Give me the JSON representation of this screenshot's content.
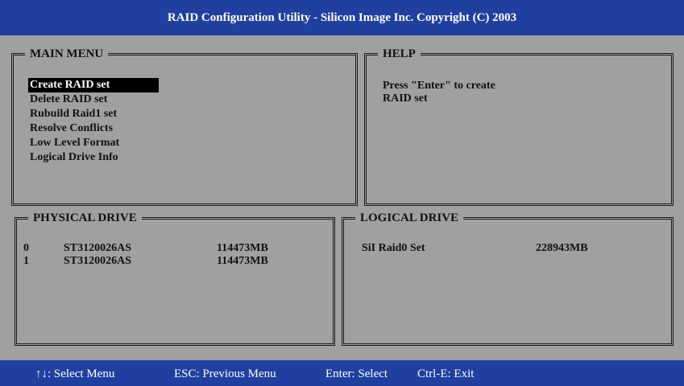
{
  "title": "RAID Configuration Utility - Silicon Image Inc. Copyright (C) 2003",
  "main_menu": {
    "title": "MAIN MENU",
    "items": [
      {
        "label": "Create RAID set",
        "selected": true
      },
      {
        "label": "Delete RAID set",
        "selected": false
      },
      {
        "label": "Rubuild Raid1 set",
        "selected": false
      },
      {
        "label": "Resolve Conflicts",
        "selected": false
      },
      {
        "label": "Low Level Format",
        "selected": false
      },
      {
        "label": "Logical Drive Info",
        "selected": false
      }
    ]
  },
  "help": {
    "title": "HELP",
    "lines": [
      "Press \"Enter\" to create",
      "RAID set"
    ]
  },
  "physical_drive": {
    "title": "PHYSICAL DRIVE",
    "rows": [
      {
        "index": "0",
        "model": "ST3120026AS",
        "size": "114473MB"
      },
      {
        "index": "1",
        "model": "ST3120026AS",
        "size": "114473MB"
      }
    ]
  },
  "logical_drive": {
    "title": "LOGICAL DRIVE",
    "rows": [
      {
        "name": "SiI Raid0 Set",
        "size": "228943MB"
      }
    ]
  },
  "status_bar": {
    "select_menu": "↑↓: Select Menu",
    "previous_menu": "ESC: Previous Menu",
    "select": "Enter: Select",
    "exit": "Ctrl-E: Exit"
  },
  "colors": {
    "bar_blue": "#2040a0",
    "panel_bg": "#a0a0a0",
    "selection": "#000000"
  }
}
